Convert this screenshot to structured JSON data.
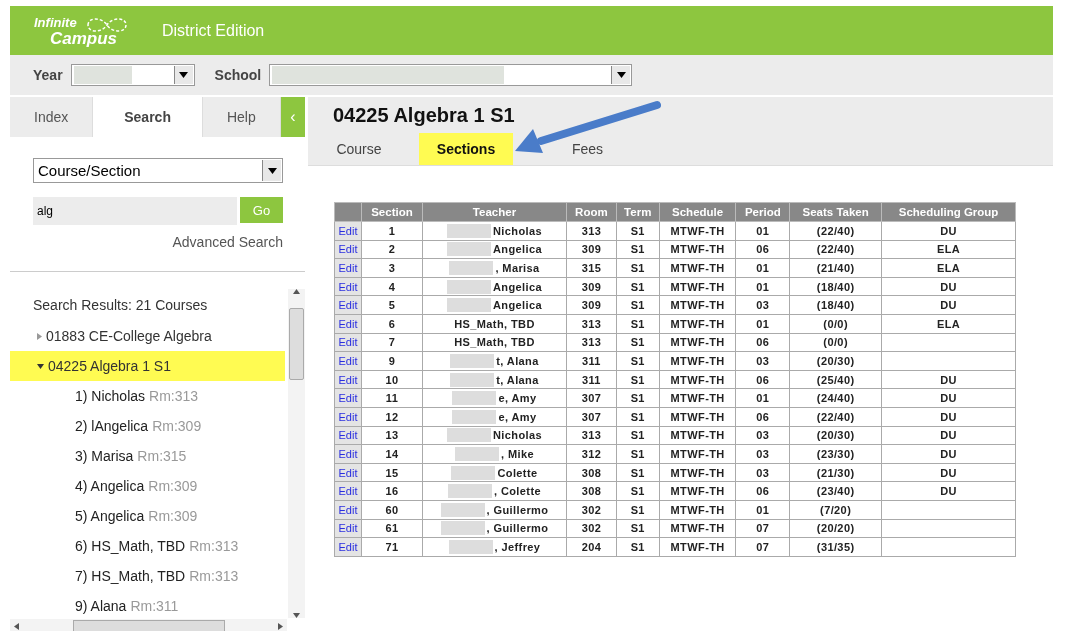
{
  "header": {
    "logo_top": "Infinite",
    "logo_bottom": "Campus",
    "edition": "District Edition"
  },
  "context_bar": {
    "year_label": "Year",
    "year_redacted": true,
    "school_label": "School",
    "school_redacted": true
  },
  "side_tabs": [
    {
      "label": "Index",
      "selected": false
    },
    {
      "label": "Search",
      "selected": true
    },
    {
      "label": "Help",
      "selected": false
    }
  ],
  "collapse_button": "‹",
  "search": {
    "type": "Course/Section",
    "value": "alg",
    "go": "Go",
    "advanced": "Advanced Search"
  },
  "results": {
    "title": "Search Results: 21 Courses",
    "items": [
      {
        "label": "01883 CE-College Algebra",
        "expanded": false,
        "selected": false
      },
      {
        "label": "04225 Algebra 1 S1",
        "expanded": true,
        "selected": true,
        "children": [
          {
            "label": "1) Nicholas",
            "room": "Rm:313"
          },
          {
            "label": "2) lAngelica",
            "room": "Rm:309"
          },
          {
            "label": "3) Marisa",
            "room": "Rm:315"
          },
          {
            "label": "4)  Angelica",
            "room": "Rm:309"
          },
          {
            "label": "5) Angelica",
            "room": "Rm:309"
          },
          {
            "label": "6) HS_Math, TBD",
            "room": "Rm:313"
          },
          {
            "label": "7) HS_Math, TBD",
            "room": "Rm:313"
          },
          {
            "label": "9) Alana",
            "room": "Rm:311"
          }
        ]
      }
    ]
  },
  "title": "04225 Algebra 1 S1",
  "tabs": [
    {
      "label": "Course",
      "selected": false
    },
    {
      "label": "Sections",
      "selected": true
    },
    {
      "label": "Fees",
      "selected": false
    }
  ],
  "table": {
    "columns": [
      "Section",
      "Teacher",
      "Room",
      "Term",
      "Schedule",
      "Period",
      "Seats Taken",
      "Scheduling Group"
    ],
    "rows": [
      {
        "edit": "Edit",
        "section": "1",
        "teacher": "Nicholas",
        "redacted": true,
        "room": "313",
        "term": "S1",
        "schedule": "MTWF-TH",
        "period": "01",
        "seats": "(22/40)",
        "group": "DU"
      },
      {
        "edit": "Edit",
        "section": "2",
        "teacher": "Angelica",
        "redacted": true,
        "room": "309",
        "term": "S1",
        "schedule": "MTWF-TH",
        "period": "06",
        "seats": "(22/40)",
        "group": "ELA"
      },
      {
        "edit": "Edit",
        "section": "3",
        "teacher": ", Marisa",
        "redacted": true,
        "room": "315",
        "term": "S1",
        "schedule": "MTWF-TH",
        "period": "01",
        "seats": "(21/40)",
        "group": "ELA"
      },
      {
        "edit": "Edit",
        "section": "4",
        "teacher": "Angelica",
        "redacted": true,
        "room": "309",
        "term": "S1",
        "schedule": "MTWF-TH",
        "period": "01",
        "seats": "(18/40)",
        "group": "DU"
      },
      {
        "edit": "Edit",
        "section": "5",
        "teacher": "Angelica",
        "redacted": true,
        "room": "309",
        "term": "S1",
        "schedule": "MTWF-TH",
        "period": "03",
        "seats": "(18/40)",
        "group": "DU"
      },
      {
        "edit": "Edit",
        "section": "6",
        "teacher": "HS_Math, TBD",
        "redacted": false,
        "room": "313",
        "term": "S1",
        "schedule": "MTWF-TH",
        "period": "01",
        "seats": "(0/0)",
        "group": "ELA"
      },
      {
        "edit": "Edit",
        "section": "7",
        "teacher": "HS_Math, TBD",
        "redacted": false,
        "room": "313",
        "term": "S1",
        "schedule": "MTWF-TH",
        "period": "06",
        "seats": "(0/0)"
      },
      {
        "edit": "Edit",
        "section": "9",
        "teacher": "t, Alana",
        "redacted": true,
        "room": "311",
        "term": "S1",
        "schedule": "MTWF-TH",
        "period": "03",
        "seats": "(20/30)"
      },
      {
        "edit": "Edit",
        "section": "10",
        "teacher": "t, Alana",
        "redacted": true,
        "room": "311",
        "term": "S1",
        "schedule": "MTWF-TH",
        "period": "06",
        "seats": "(25/40)",
        "group": "DU"
      },
      {
        "edit": "Edit",
        "section": "11",
        "teacher": "e, Amy",
        "redacted": true,
        "room": "307",
        "term": "S1",
        "schedule": "MTWF-TH",
        "period": "01",
        "seats": "(24/40)",
        "group": "DU"
      },
      {
        "edit": "Edit",
        "section": "12",
        "teacher": "e, Amy",
        "redacted": true,
        "room": "307",
        "term": "S1",
        "schedule": "MTWF-TH",
        "period": "06",
        "seats": "(22/40)",
        "group": "DU"
      },
      {
        "edit": "Edit",
        "section": "13",
        "teacher": "Nicholas",
        "redacted": true,
        "room": "313",
        "term": "S1",
        "schedule": "MTWF-TH",
        "period": "03",
        "seats": "(20/30)",
        "group": "DU"
      },
      {
        "edit": "Edit",
        "section": "14",
        "teacher": ", Mike",
        "redacted": true,
        "room": "312",
        "term": "S1",
        "schedule": "MTWF-TH",
        "period": "03",
        "seats": "(23/30)",
        "group": "DU"
      },
      {
        "edit": "Edit",
        "section": "15",
        "teacher": "Colette",
        "redacted": true,
        "room": "308",
        "term": "S1",
        "schedule": "MTWF-TH",
        "period": "03",
        "seats": "(21/30)",
        "group": "DU"
      },
      {
        "edit": "Edit",
        "section": "16",
        "teacher": ", Colette",
        "redacted": true,
        "room": "308",
        "term": "S1",
        "schedule": "MTWF-TH",
        "period": "06",
        "seats": "(23/40)",
        "group": "DU"
      },
      {
        "edit": "Edit",
        "section": "60",
        "teacher": ", Guillermo",
        "redacted": true,
        "room": "302",
        "term": "S1",
        "schedule": "MTWF-TH",
        "period": "01",
        "seats": "(7/20)"
      },
      {
        "edit": "Edit",
        "section": "61",
        "teacher": ", Guillermo",
        "redacted": true,
        "room": "302",
        "term": "S1",
        "schedule": "MTWF-TH",
        "period": "07",
        "seats": "(20/20)"
      },
      {
        "edit": "Edit",
        "section": "71",
        "teacher": ", Jeffrey",
        "redacted": true,
        "room": "204",
        "term": "S1",
        "schedule": "MTWF-TH",
        "period": "07",
        "seats": "(31/35)"
      }
    ]
  }
}
